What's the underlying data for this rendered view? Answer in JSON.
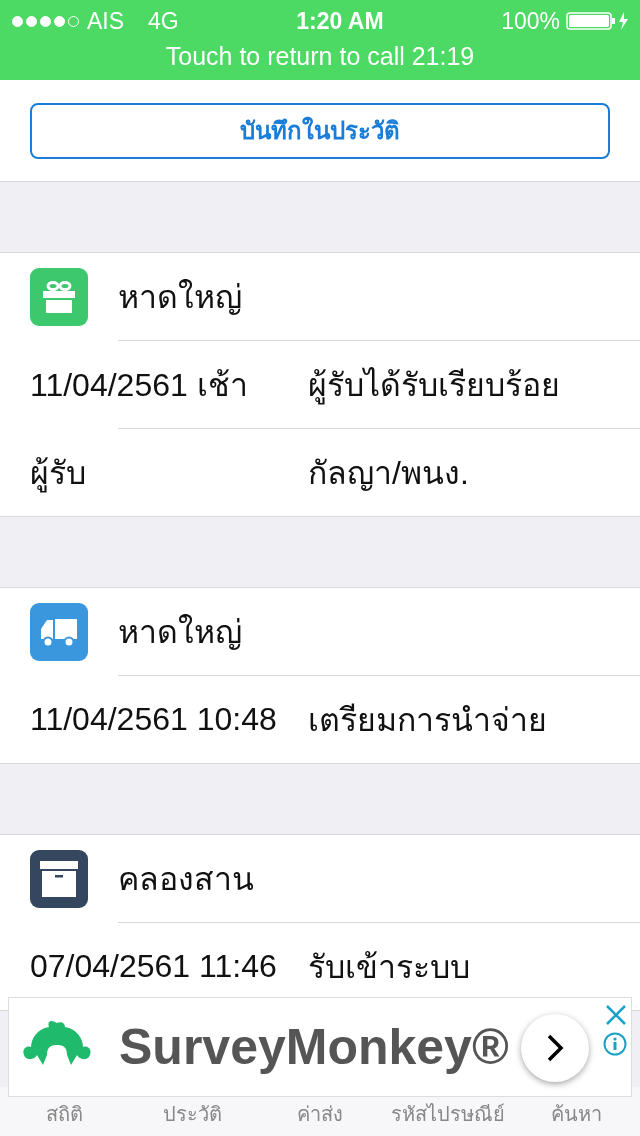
{
  "status_bar": {
    "signal_dots": [
      {
        "on": true
      },
      {
        "on": true
      },
      {
        "on": true
      },
      {
        "on": true
      },
      {
        "on": false
      }
    ],
    "carrier": "AIS",
    "network": "4G",
    "time": "1:20 AM",
    "battery": "100%",
    "call_banner": "Touch to return to call 21:19"
  },
  "save_button": "บันทึกในประวัติ",
  "events": [
    {
      "kind": "gift",
      "color": "#3dc86e",
      "place": "หาดใหญ่",
      "rows": [
        {
          "label": "11/04/2561 เช้า",
          "value": "ผู้รับได้รับเรียบร้อย"
        },
        {
          "label": "ผู้รับ",
          "value": "กัลญา/พนง."
        }
      ]
    },
    {
      "kind": "truck",
      "color": "#3a97de",
      "place": "หาดใหญ่",
      "rows": [
        {
          "label": "11/04/2561 10:48",
          "value": "เตรียมการนำจ่าย"
        }
      ]
    },
    {
      "kind": "box",
      "color": "#34475f",
      "place": "คลองสาน",
      "rows": [
        {
          "label": "07/04/2561 11:46",
          "value": "รับเข้าระบบ"
        }
      ]
    }
  ],
  "ad": {
    "brand": "SurveyMonkey®"
  },
  "tab_bar": [
    {
      "label": "สถิติ",
      "selected": false
    },
    {
      "label": "ประวัติ",
      "selected": false
    },
    {
      "label": "ค่าส่ง",
      "selected": false
    },
    {
      "label": "รหัสไปรษณีย์",
      "selected": false
    },
    {
      "label": "ค้นหา",
      "selected": false
    }
  ]
}
